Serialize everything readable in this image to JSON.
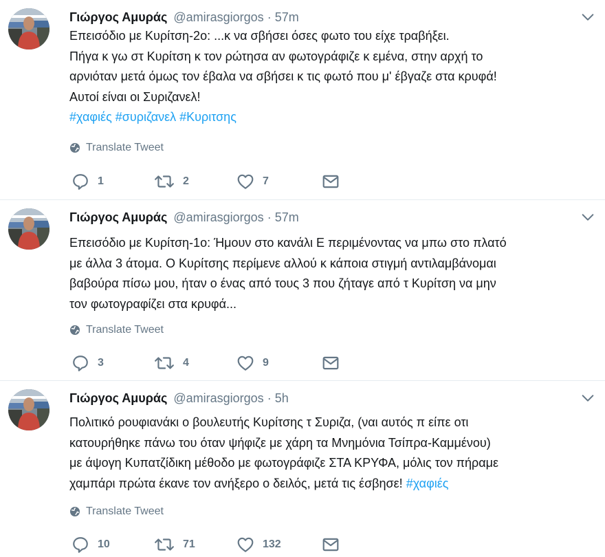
{
  "colors": {
    "link": "#1da1f2",
    "muted": "#657786",
    "text": "#14171a",
    "divider": "#e6ecf0"
  },
  "icons": [
    "avatar",
    "chevron-down-icon",
    "globe-icon",
    "reply-icon",
    "retweet-icon",
    "like-icon",
    "message-icon"
  ],
  "tweets": [
    {
      "name": "Γιώργος Αμυράς",
      "handle": "@amirasgiorgos",
      "dot": "·",
      "time": "57m",
      "lines": [
        "Επεισόδιο με Κυρίτση-2ο:  ...κ να σβήσει όσες φωτο του είχε τραβήξει.",
        "Πήγα κ γω στ Κυρίτση κ τον ρώτησα αν φωτογράφιζε κ εμένα, στην αρχή το",
        "αρνιόταν μετά όμως τον έβαλα να σβήσει κ τις φωτό που μ' έβγαζε στα κρυφά!",
        "Αυτοί είναι οι Συριζανελ!"
      ],
      "hashtags": "#χαφιές #συριζανελ #Κυριτσης",
      "translate": "Translate Tweet",
      "replies": "1",
      "retweets": "2",
      "likes": "7"
    },
    {
      "name": "Γιώργος Αμυράς",
      "handle": "@amirasgiorgos",
      "dot": "·",
      "time": "57m",
      "lines": [
        "Επεισόδιο με Κυρίτση-1ο: Ήμουν στο κανάλι Ε περιμένοντας να μπω στο πλατό",
        "με άλλα 3 άτομα. Ο Κυρίτσης περίμενε αλλού κ κάποια στιγμή αντιλαμβάνομαι",
        "βαβούρα πίσω μου, ήταν ο ένας από τους 3 που ζήταγε από τ Κυρίτση να μην",
        "τον φωτογραφίζει στα κρυφά..."
      ],
      "translate": "Translate Tweet",
      "replies": "3",
      "retweets": "4",
      "likes": "9"
    },
    {
      "name": "Γιώργος Αμυράς",
      "handle": "@amirasgiorgos",
      "dot": "·",
      "time": "5h",
      "lines": [
        "Πολιτικό ρουφιανάκι ο βουλευτής Κυρίτσης τ Συριζα, (ναι αυτός π είπε οτι",
        "κατουρήθηκε πάνω του όταν ψήφιζε με χάρη τα Μνημόνια Τσίπρα-Καμμένου)",
        "με άψογη Κυπατζίδικη μέθοδο με φωτογράφιζε ΣΤΑ ΚΡΥΦΑ, μόλις τον πήραμε",
        "χαμπάρι πρώτα έκανε τον ανήξερο ο δειλός, μετά τις έσβησε!"
      ],
      "last_hashtag": "#χαφιές",
      "translate": "Translate Tweet",
      "replies": "10",
      "retweets": "71",
      "likes": "132"
    }
  ]
}
